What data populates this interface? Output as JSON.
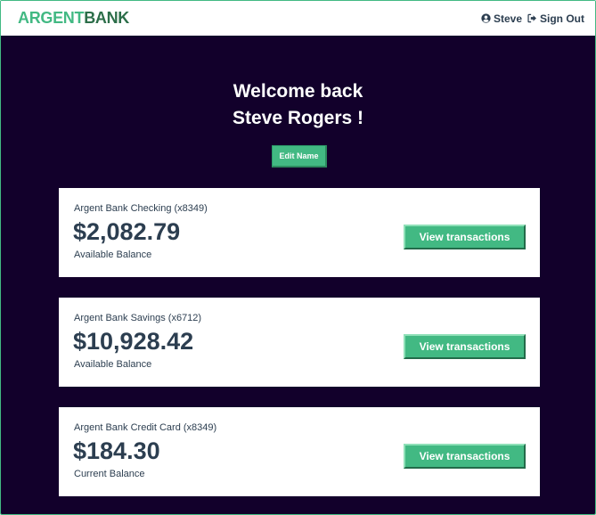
{
  "nav": {
    "logo_part1": "ARGENT",
    "logo_part2": "BANK",
    "user_label": "Steve",
    "user_icon": "user-circle-icon",
    "signout_label": "Sign Out",
    "signout_icon": "sign-out-icon"
  },
  "header": {
    "line1": "Welcome back",
    "line2": "Steve Rogers !",
    "edit_label": "Edit Name"
  },
  "accounts": [
    {
      "title": "Argent Bank Checking (x8349)",
      "amount": "$2,082.79",
      "description": "Available Balance",
      "button": "View transactions"
    },
    {
      "title": "Argent Bank Savings (x6712)",
      "amount": "$10,928.42",
      "description": "Available Balance",
      "button": "View transactions"
    },
    {
      "title": "Argent Bank Credit Card (x8349)",
      "amount": "$184.30",
      "description": "Current Balance",
      "button": "View transactions"
    }
  ],
  "colors": {
    "accent": "#42b983",
    "background": "#12002b",
    "text": "#2c3e50"
  }
}
